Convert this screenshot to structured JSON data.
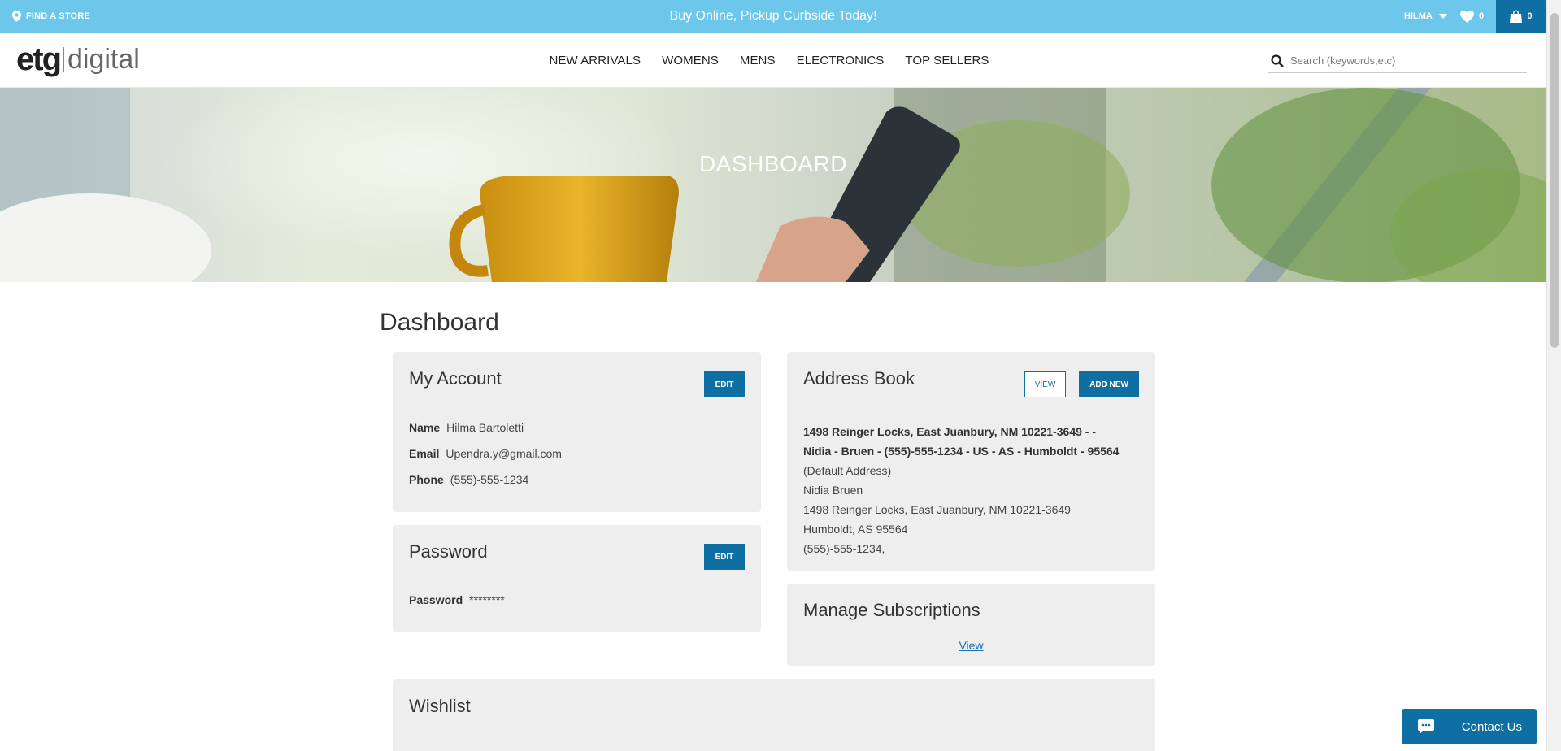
{
  "topbar": {
    "find_store": "FIND A STORE",
    "promo": "Buy Online, Pickup Curbside Today!",
    "user_name": "HILMA",
    "wishlist_count": "0",
    "cart_count": "0"
  },
  "header": {
    "logo_etg": "etg",
    "logo_digital": "digital",
    "nav": [
      "NEW ARRIVALS",
      "WOMENS",
      "MENS",
      "ELECTRONICS",
      "TOP SELLERS"
    ],
    "search_placeholder": "Search (keywords,etc)"
  },
  "hero": {
    "title": "DASHBOARD"
  },
  "page_title": "Dashboard",
  "my_account": {
    "title": "My Account",
    "edit_label": "EDIT",
    "name_label": "Name",
    "name_value": "Hilma Bartoletti",
    "email_label": "Email",
    "email_value": "Upendra.y@gmail.com",
    "phone_label": "Phone",
    "phone_value": "(555)-555-1234"
  },
  "password": {
    "title": "Password",
    "edit_label": "EDIT",
    "label": "Password",
    "value": "********"
  },
  "address_book": {
    "title": "Address Book",
    "view_label": "VIEW",
    "add_new_label": "ADD NEW",
    "summary_line1": "1498 Reinger Locks, East Juanbury, NM 10221-3649 - -",
    "summary_line2": "Nidia - Bruen - (555)-555-1234 - US - AS - Humboldt - 95564",
    "default_label": "(Default Address)",
    "name": "Nidia  Bruen",
    "street": "1498 Reinger Locks, East Juanbury, NM 10221-3649",
    "city_line": "Humboldt,  AS  95564",
    "phone": "(555)-555-1234,"
  },
  "subscriptions": {
    "title": "Manage Subscriptions",
    "view_link": "View"
  },
  "wishlist": {
    "title": "Wishlist"
  },
  "chat": {
    "label": "Contact Us"
  },
  "colors": {
    "topbar": "#6cc7ea",
    "primary": "#0f6fa3",
    "card": "#eeeeee"
  }
}
